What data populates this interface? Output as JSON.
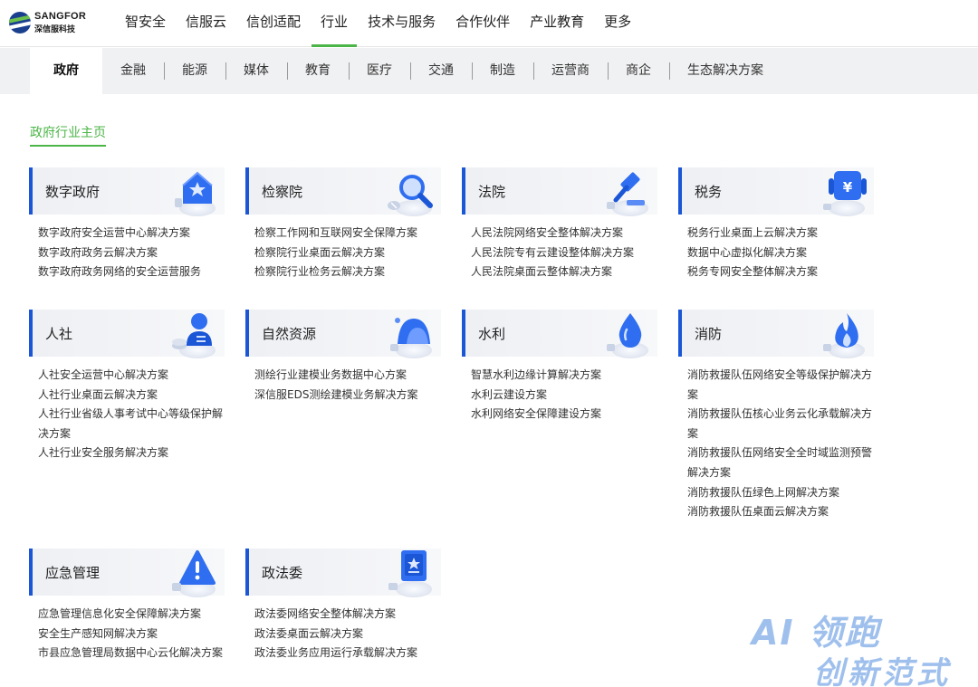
{
  "logo": {
    "en": "SANGFOR",
    "cn": "深信服科技"
  },
  "nav": [
    "智安全",
    "信服云",
    "信创适配",
    "行业",
    "技术与服务",
    "合作伙伴",
    "产业教育",
    "更多"
  ],
  "nav_active": "行业",
  "subnav": [
    "政府",
    "金融",
    "能源",
    "媒体",
    "教育",
    "医疗",
    "交通",
    "制造",
    "运营商",
    "商企",
    "生态解决方案"
  ],
  "subnav_active": "政府",
  "page_title": "政府行业主页",
  "cards": [
    {
      "title": "数字政府",
      "icon": "house-star-icon",
      "items": [
        "数字政府安全运营中心解决方案",
        "数字政府政务云解决方案",
        "数字政府政务网络的安全运营服务"
      ]
    },
    {
      "title": "检察院",
      "icon": "magnifier-icon",
      "items": [
        "检察工作网和互联网安全保障方案",
        "检察院行业桌面云解决方案",
        "检察院行业检务云解决方案"
      ]
    },
    {
      "title": "法院",
      "icon": "gavel-icon",
      "items": [
        "人民法院网络安全整体解决方案",
        "人民法院专有云建设整体解决方案",
        "人民法院桌面云整体解决方案"
      ]
    },
    {
      "title": "税务",
      "icon": "yuan-icon",
      "items": [
        "税务行业桌面上云解决方案",
        "数据中心虚拟化解决方案",
        "税务专网安全整体解决方案"
      ]
    },
    {
      "title": "人社",
      "icon": "person-icon",
      "items": [
        "人社安全运营中心解决方案",
        "人社行业桌面云解决方案",
        "人社行业省级人事考试中心等级保护解",
        "决方案",
        "人社行业安全服务解决方案"
      ]
    },
    {
      "title": "自然资源",
      "icon": "mountain-icon",
      "items": [
        "测绘行业建模业务数据中心方案",
        "深信服EDS测绘建模业务解决方案"
      ]
    },
    {
      "title": "水利",
      "icon": "water-drop-icon",
      "items": [
        "智慧水利边缘计算解决方案",
        "水利云建设方案",
        "水利网络安全保障建设方案"
      ]
    },
    {
      "title": "消防",
      "icon": "flame-icon",
      "items": [
        "消防救援队伍网络安全等级保护解决方",
        "案",
        "消防救援队伍核心业务云化承载解决方",
        "案",
        "消防救援队伍网络安全全时域监测预警",
        "解决方案",
        "消防救援队伍绿色上网解决方案",
        "消防救援队伍桌面云解决方案"
      ]
    },
    {
      "title": "应急管理",
      "icon": "warning-icon",
      "items": [
        "应急管理信息化安全保障解决方案",
        "安全生产感知网解决方案",
        "市县应急管理局数据中心云化解决方案"
      ]
    },
    {
      "title": "政法委",
      "icon": "badge-icon",
      "items": [
        "政法委网络安全整体解决方案",
        "政法委桌面云解决方案",
        "政法委业务应用运行承载解决方案"
      ]
    }
  ],
  "watermark": {
    "line1": "AI 领跑",
    "line2": "创新范式"
  },
  "colors": {
    "accent_green": "#4cb548",
    "accent_blue": "#1a56d6"
  }
}
